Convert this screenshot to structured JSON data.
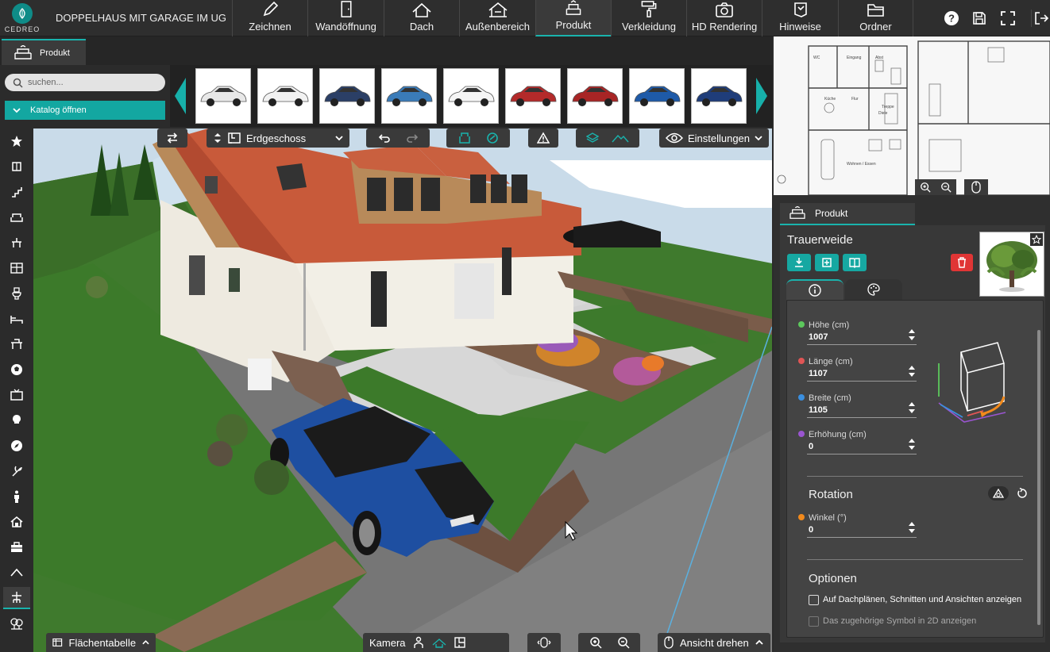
{
  "app": {
    "logo_text": "CEDREO",
    "project_title": "DOPPELHAUS MIT GARAGE IM UG"
  },
  "nav": [
    {
      "label": "Zeichnen",
      "icon": "pencil-icon"
    },
    {
      "label": "Wandöffnung",
      "icon": "door-icon"
    },
    {
      "label": "Dach",
      "icon": "roof-icon"
    },
    {
      "label": "Außenbereich",
      "icon": "garden-icon"
    },
    {
      "label": "Produkt",
      "icon": "sofa-icon",
      "active": true
    },
    {
      "label": "Verkleidung",
      "icon": "paint-roller-icon"
    },
    {
      "label": "HD Rendering",
      "icon": "camera-icon"
    },
    {
      "label": "Hinweise",
      "icon": "notes-icon"
    },
    {
      "label": "Ordner",
      "icon": "folder-icon"
    }
  ],
  "top_right_icons": [
    "help-icon",
    "save-icon",
    "fullscreen-icon",
    "logout-icon"
  ],
  "subbar": {
    "tab_label": "Produkt"
  },
  "catalog": {
    "search_placeholder": "suchen...",
    "open_catalog_label": "Katalog öffnen",
    "thumbnail_colors": [
      "#e8e8e8",
      "#f2f2f2",
      "#2b3f66",
      "#3a7bb8",
      "#f5f5f5",
      "#b32a2a",
      "#a82525",
      "#1e5aa8",
      "#1f3d7a"
    ]
  },
  "tools": [
    "star-icon",
    "window-icon",
    "staircase-icon",
    "sofa-icon",
    "dining-icon",
    "kitchen-icon",
    "toilet-icon",
    "bed-icon",
    "office-icon",
    "ball-icon",
    "tv-icon",
    "lamp-icon",
    "compass-icon",
    "plant-icon",
    "person-icon",
    "house-icon",
    "toolbox-icon",
    "roof-line-icon",
    "garden-furniture-icon",
    "trees-icon"
  ],
  "viewport_toolbar": {
    "floor_label": "Erdgeschoss",
    "settings_label": "Einstellungen"
  },
  "bottom": {
    "area_table_label": "Flächentabelle",
    "camera_label": "Kamera",
    "rotate_view_label": "Ansicht drehen"
  },
  "panel": {
    "tab_label": "Produkt",
    "product_name": "Trauerweide",
    "fields": [
      {
        "label": "Höhe (cm)",
        "value": "1007",
        "color": "#5cc85c"
      },
      {
        "label": "Länge (cm)",
        "value": "1107",
        "color": "#e05555"
      },
      {
        "label": "Breite (cm)",
        "value": "1105",
        "color": "#3a8fe0"
      },
      {
        "label": "Erhöhung (cm)",
        "value": "0",
        "color": "#9a55d0"
      }
    ],
    "rotation_title": "Rotation",
    "angle_label": "Winkel (°)",
    "angle_value": "0",
    "angle_color": "#f28a1c",
    "options_title": "Optionen",
    "option1": "Auf Dachplänen, Schnitten und Ansichten anzeigen",
    "option2": "Das zugehörige Symbol in 2D anzeigen"
  },
  "colors": {
    "accent": "#19b3ad",
    "delete": "#e03535"
  }
}
